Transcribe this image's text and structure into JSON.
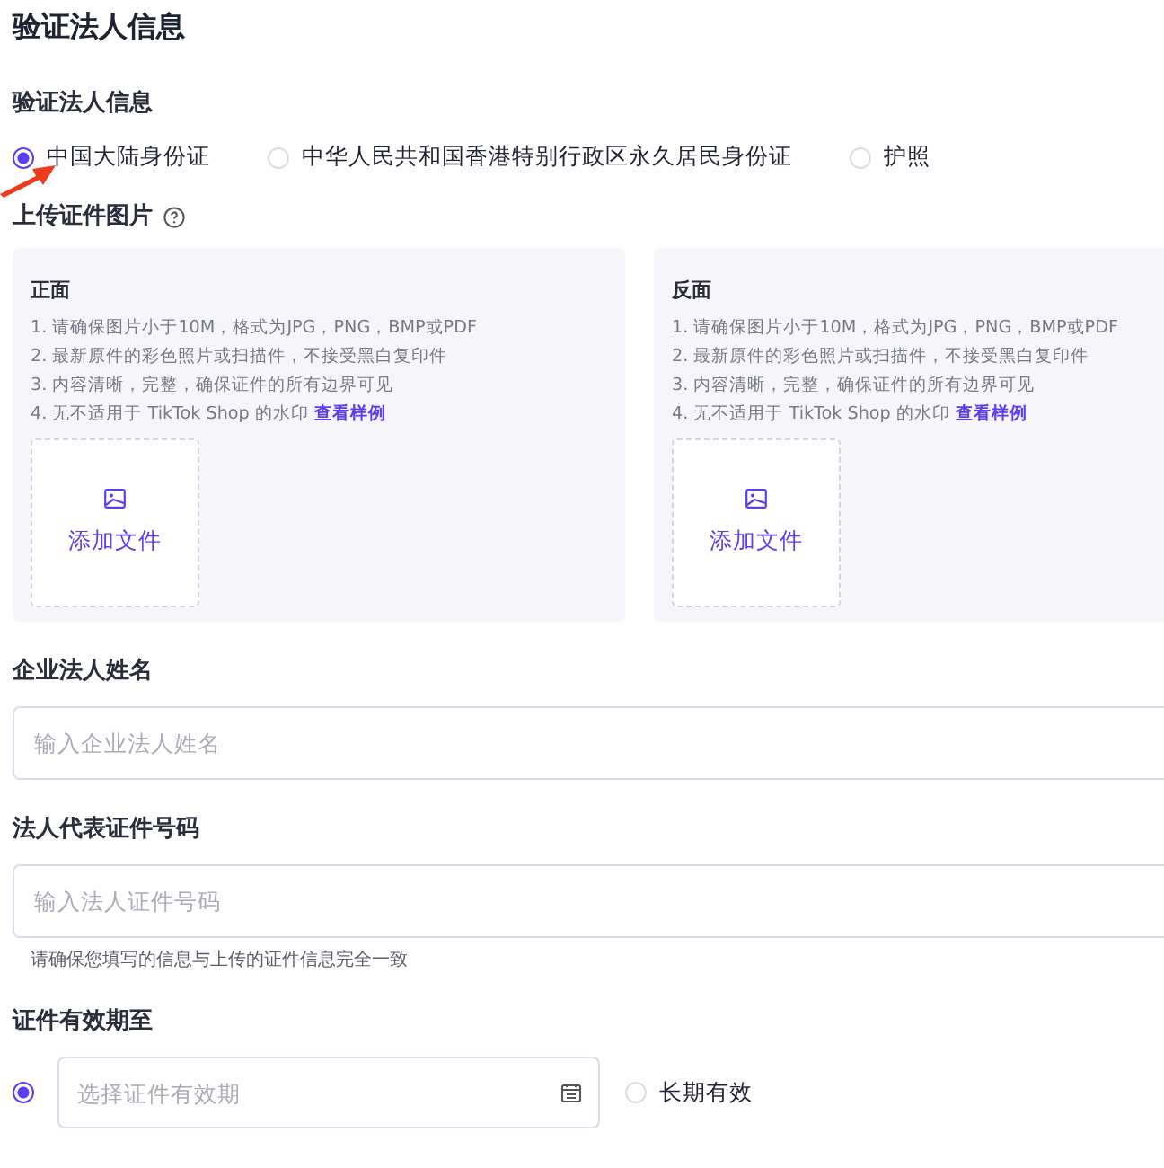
{
  "page_title": "验证法人信息",
  "identity": {
    "label": "验证法人信息",
    "options": [
      {
        "label": "中国大陆身份证",
        "selected": true
      },
      {
        "label": "中华人民共和国香港特别行政区永久居民身份证",
        "selected": false
      },
      {
        "label": "护照",
        "selected": false
      }
    ]
  },
  "upload": {
    "label": "上传证件图片",
    "cards": [
      {
        "title": "正面",
        "rules": [
          "1. 请确保图片小于10M，格式为JPG，PNG，BMP或PDF",
          "2. 最新原件的彩色照片或扫描件，不接受黑白复印件",
          "3. 内容清晰，完整，确保证件的所有边界可见",
          "4. 无不适用于 TikTok Shop 的水印"
        ],
        "link": "查看样例",
        "add_label": "添加文件"
      },
      {
        "title": "反面",
        "rules": [
          "1. 请确保图片小于10M，格式为JPG，PNG，BMP或PDF",
          "2. 最新原件的彩色照片或扫描件，不接受黑白复印件",
          "3. 内容清晰，完整，确保证件的所有边界可见",
          "4. 无不适用于 TikTok Shop 的水印"
        ],
        "link": "查看样例",
        "add_label": "添加文件"
      }
    ]
  },
  "fields": [
    {
      "label": "企业法人姓名",
      "placeholder": "输入企业法人姓名"
    },
    {
      "label": "法人代表证件号码",
      "placeholder": "输入法人证件号码",
      "hint": "请确保您填写的信息与上传的证件信息完全一致"
    }
  ],
  "expiry": {
    "label": "证件有效期至",
    "options": [
      {
        "kind": "date",
        "placeholder": "选择证件有效期",
        "selected": true
      },
      {
        "kind": "permanent",
        "label": "长期有效",
        "selected": false
      }
    ]
  }
}
